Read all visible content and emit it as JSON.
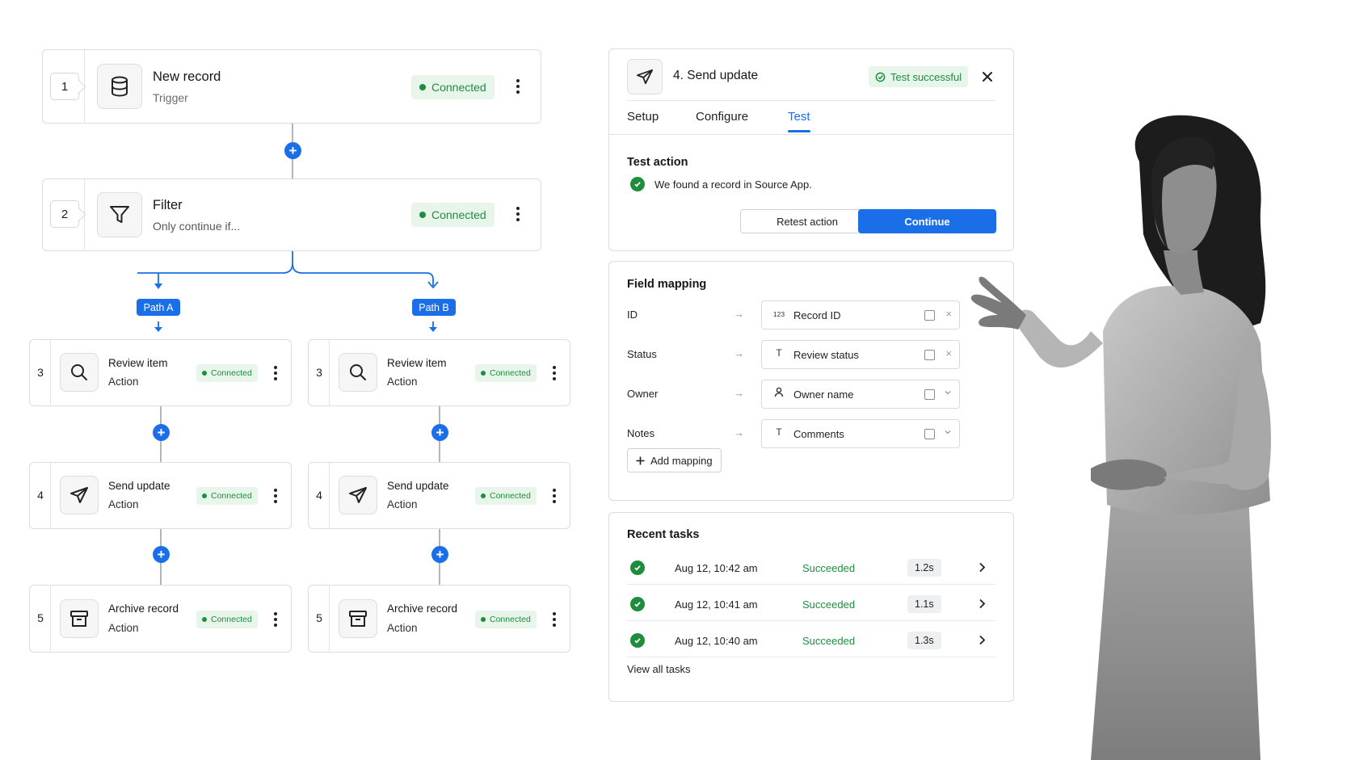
{
  "workflow": {
    "steps": [
      {
        "number": "1",
        "title": "New record",
        "subtitle": "Trigger",
        "status": "Connected",
        "icon": "database-icon"
      },
      {
        "number": "2",
        "title": "Filter",
        "subtitle": "Only continue if...",
        "status": "Connected",
        "icon": "filter-icon"
      }
    ],
    "paths": [
      {
        "label": "Path A",
        "steps": [
          {
            "number": "3",
            "title": "Review item",
            "subtitle": "Action",
            "status": "Connected",
            "icon": "search-icon"
          },
          {
            "number": "4",
            "title": "Send update",
            "subtitle": "Action",
            "status": "Connected",
            "icon": "send-icon"
          },
          {
            "number": "5",
            "title": "Archive record",
            "subtitle": "Action",
            "status": "Connected",
            "icon": "archive-icon"
          }
        ]
      },
      {
        "label": "Path B",
        "steps": [
          {
            "number": "3",
            "title": "Review item",
            "subtitle": "Action",
            "status": "Connected",
            "icon": "search-icon"
          },
          {
            "number": "4",
            "title": "Send update",
            "subtitle": "Action",
            "status": "Connected",
            "icon": "send-icon"
          },
          {
            "number": "5",
            "title": "Archive record",
            "subtitle": "Action",
            "status": "Connected",
            "icon": "archive-icon"
          }
        ]
      }
    ]
  },
  "detail": {
    "title": "4. Send update",
    "test_badge": "Test successful",
    "tabs": [
      {
        "label": "Setup",
        "active": false
      },
      {
        "label": "Configure",
        "active": false
      },
      {
        "label": "Test",
        "active": true
      }
    ],
    "test_action": {
      "heading": "Test action",
      "message": "We found a record in Source App.",
      "retest_label": "Retest action",
      "continue_label": "Continue"
    }
  },
  "field_mapping": {
    "heading": "Field mapping",
    "rows": [
      {
        "label": "ID",
        "type_icon": "123",
        "value": "Record ID",
        "end_icon": "clear-icon"
      },
      {
        "label": "Status",
        "type_icon": "T",
        "value": "Review status",
        "end_icon": "clear-icon"
      },
      {
        "label": "Owner",
        "type_icon": "person-icon",
        "value": "Owner name",
        "end_icon": "chevron-down-icon"
      },
      {
        "label": "Notes",
        "type_icon": "T",
        "value": "Comments",
        "end_icon": "chevron-down-icon"
      }
    ],
    "add_label": "Add mapping"
  },
  "recent_tasks": {
    "heading": "Recent tasks",
    "tasks": [
      {
        "time": "Aug 12, 10:42 am",
        "status": "Succeeded",
        "duration": "1.2s"
      },
      {
        "time": "Aug 12, 10:41 am",
        "status": "Succeeded",
        "duration": "1.1s"
      },
      {
        "time": "Aug 12, 10:40 am",
        "status": "Succeeded",
        "duration": "1.3s"
      }
    ],
    "view_all_label": "View all tasks"
  },
  "colors": {
    "accent": "#1a6fe8",
    "success": "#1e8e3e",
    "success_bg": "#e8f5ea",
    "border": "#dcdde1"
  }
}
